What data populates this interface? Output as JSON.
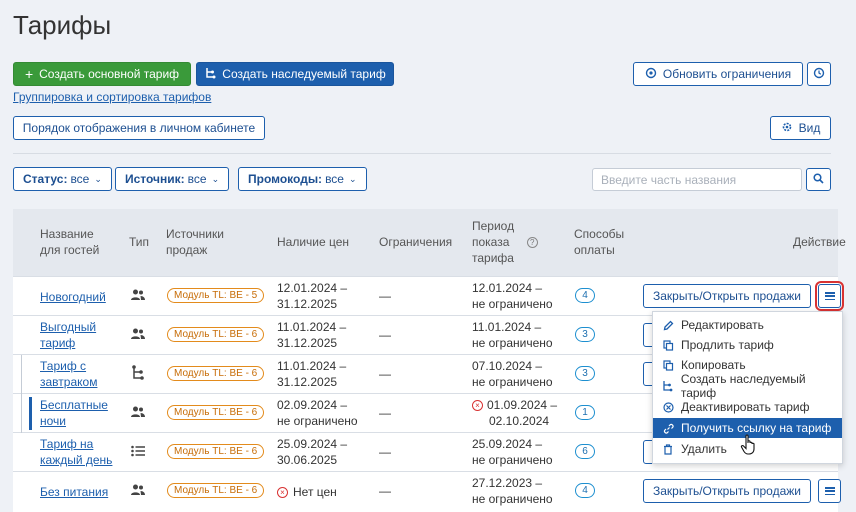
{
  "page": {
    "title": "Тарифы"
  },
  "toolbar": {
    "create_main_label": "Создать основной тариф",
    "create_inherited_label": "Создать наследуемый тариф",
    "update_limits_label": "Обновить ограничения",
    "grouping_link": "Группировка и сортировка тарифов",
    "display_order_label": "Порядок отображения в личном кабинете",
    "view_label": "Вид"
  },
  "filters": {
    "status": {
      "label": "Статус:",
      "value": "все"
    },
    "source": {
      "label": "Источник:",
      "value": "все"
    },
    "promo": {
      "label": "Промокоды:",
      "value": "все"
    },
    "search_placeholder": "Введите часть названия"
  },
  "table": {
    "headers": {
      "name": [
        "Название",
        "для гостей"
      ],
      "type": "Тип",
      "sources": [
        "Источники",
        "продаж"
      ],
      "prices": "Наличие цен",
      "limits": "Ограничения",
      "period": [
        "Период",
        "показа",
        "тарифа"
      ],
      "payment": [
        "Способы",
        "оплаты"
      ],
      "action": "Действие"
    },
    "rows": [
      {
        "name": [
          "Новогодний"
        ],
        "type_icon": "people-icon",
        "source": "Модуль TL: BE - 5",
        "prices": [
          "12.01.2024 –",
          "31.12.2025"
        ],
        "limits": "—",
        "period": [
          "12.01.2024 –",
          "не ограничено"
        ],
        "payment": "4",
        "action": "Закрыть/Открыть продажи"
      },
      {
        "name": [
          "Выгодный",
          "тариф"
        ],
        "type_icon": "people-icon",
        "source": "Модуль TL: BE - 6",
        "prices": [
          "11.01.2024 –",
          "31.12.2025"
        ],
        "limits": "—",
        "period": [
          "11.01.2024 –",
          "не ограничено"
        ],
        "payment": "3",
        "action": ""
      },
      {
        "name": [
          "Тариф с",
          "завтраком"
        ],
        "type_icon": "inherit-icon",
        "source": "Модуль TL: BE - 6",
        "prices": [
          "11.01.2024 –",
          "31.12.2025"
        ],
        "limits": "—",
        "period": [
          "07.10.2024 –",
          "не ограничено"
        ],
        "payment": "3",
        "action": ""
      },
      {
        "name": [
          "Бесплатные",
          "ночи"
        ],
        "type_icon": "people-icon",
        "source": "Модуль TL: BE - 6",
        "prices": [
          "02.09.2024 –",
          "не ограничено"
        ],
        "limits": "—",
        "period": [
          "01.09.2024 –",
          "02.10.2024"
        ],
        "payment": "1",
        "action": ""
      },
      {
        "name": [
          "Тариф на",
          "каждый день"
        ],
        "type_icon": "list-icon",
        "source": "Модуль TL: BE - 6",
        "prices": [
          "25.09.2024 –",
          "30.06.2025"
        ],
        "limits": "—",
        "period": [
          "25.09.2024 –",
          "не ограничено"
        ],
        "payment": "6",
        "action": ""
      },
      {
        "name": [
          "Без питания"
        ],
        "type_icon": "people-icon",
        "source": "Модуль TL: BE - 6",
        "prices": [
          "Нет цен"
        ],
        "limits": "—",
        "period": [
          "27.12.2023 –",
          "не ограничено"
        ],
        "payment": "4",
        "action": "Закрыть/Открыть продажи"
      }
    ]
  },
  "dropdown": {
    "items": [
      {
        "label": "Редактировать",
        "icon": "pencil-icon"
      },
      {
        "label": "Продлить тариф",
        "icon": "copy-icon"
      },
      {
        "label": "Копировать",
        "icon": "copy-icon"
      },
      {
        "label": "Создать наследуемый тариф",
        "icon": "inherit-icon"
      },
      {
        "label": "Деактивировать тариф",
        "icon": "x-circle-icon"
      },
      {
        "label": "Получить ссылку на тариф",
        "icon": "link-icon",
        "active": true
      },
      {
        "label": "Удалить",
        "icon": "trash-icon"
      }
    ]
  },
  "colors": {
    "accent": "#1d5fad",
    "green": "#3a9a3a",
    "badge": "#e38b1c",
    "alert": "#d83232"
  }
}
